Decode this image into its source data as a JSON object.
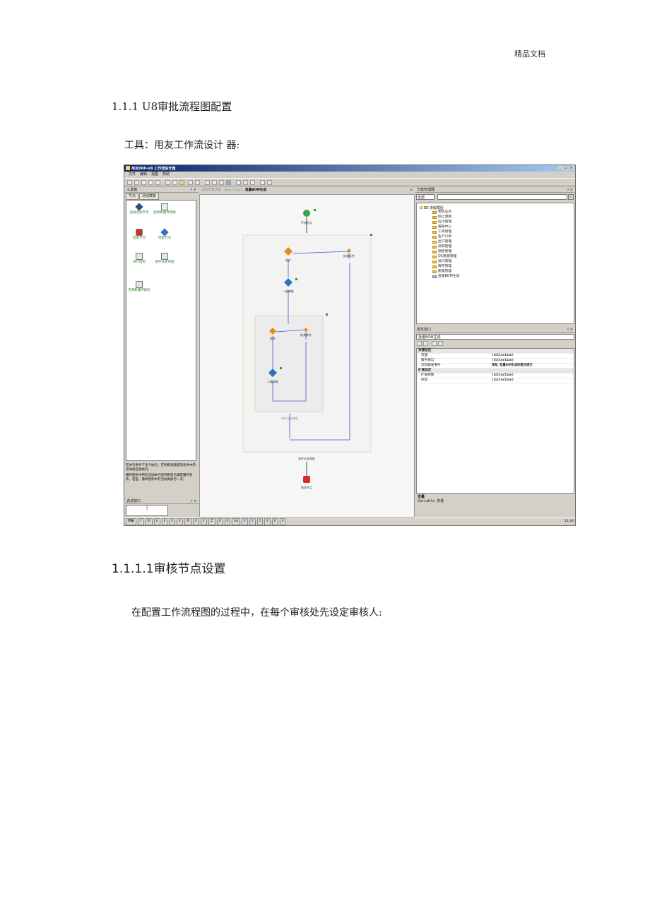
{
  "page": {
    "header_right": "精品文档",
    "heading1": "1.1.1 U8审批流程图配置",
    "tools_line": "工具：用友工作流设计 器:",
    "heading2": "1.1.1.1审核节点设置",
    "paragraph": "在配置工作流程图的过程中，在每个审核处先设定审核人:"
  },
  "app": {
    "title": "用友ERP-U8 工作流设计器",
    "window_buttons": [
      "_",
      "▫",
      "×"
    ],
    "menu": [
      "文件",
      "编辑",
      "视图",
      "帮助"
    ],
    "toolbox": {
      "title": "工具箱",
      "pin": "♯ ×",
      "tabs": [
        "节点",
        "活动模板"
      ],
      "items": [
        "自动活动节点",
        "后判断循环结构",
        "结束节点",
        "审批节点",
        "并行结构",
        "条件分支审批",
        "先判断循环结构"
      ],
      "description_1": "在并行条件下多个执行，在判断到满足的条件中的活动就全部执行。",
      "description_2": "循环结构中所有活动执行后判断是否满足循环条件，若是，循环结构中的活动再执行一次。"
    },
    "variables": {
      "title": "调试窗口",
      "pin": "♯ ×",
      "value": "|"
    },
    "document": {
      "tabs": [
        "起始审批流程",
        "sydx_f.xxxx",
        "批量BOM生成"
      ],
      "active_tab_index": 2,
      "close": "×"
    },
    "flow": {
      "start_label": "开始节点",
      "branch1_label": "条件",
      "merge1_label": "结束条件",
      "approve1_label": "一级审批",
      "branch2_label": "条件",
      "merge2_label": "结束条件",
      "approve2_label": "二级审批",
      "inner_footer": "条件分支审批",
      "outer_footer": "条件分支审批",
      "end_label": "结束节点"
    },
    "solution": {
      "title": "方案管理器",
      "pin": "♯ ×",
      "combo": "全部",
      "root": "流程模型",
      "items": [
        "物流业务",
        "网上营销",
        "应付管理",
        "报账中心",
        "工资管理",
        "生产订单",
        "出口管理",
        "采购管理",
        "销售管理",
        "QC质量管理",
        "进口管理",
        "库存管理",
        "质量管理",
        "批量BOM生成"
      ]
    },
    "properties": {
      "title": "属性窗口",
      "pin": "♯ ×",
      "object": "批量BOM生成",
      "rows": [
        {
          "k": "关键设定",
          "v": "",
          "cat": true
        },
        {
          "k": "页面",
          "v": "(Collection)",
          "cat": false
        },
        {
          "k": "服务接口",
          "v": "(Collection)",
          "cat": false
        },
        {
          "k": "流程触发事件",
          "v": "审批 批量BOM生成的提交提交",
          "cat": false
        },
        {
          "k": "扩展设定",
          "v": "",
          "cat": true
        },
        {
          "k": "扩展参数",
          "v": "(Collection)",
          "cat": false
        },
        {
          "k": "标签",
          "v": "(Collection)",
          "cat": false
        }
      ],
      "desc_title": "变量",
      "desc_text": "Variable 变量"
    },
    "taskbar": {
      "start": "开始",
      "tasks": [
        "C",
        "用",
        "E",
        "E",
        "E",
        "E",
        "用",
        "E",
        "E",
        "工",
        "E",
        "E",
        "U8",
        "E",
        "E",
        "2",
        "E",
        "E",
        "E"
      ],
      "clock": "11:40"
    }
  }
}
